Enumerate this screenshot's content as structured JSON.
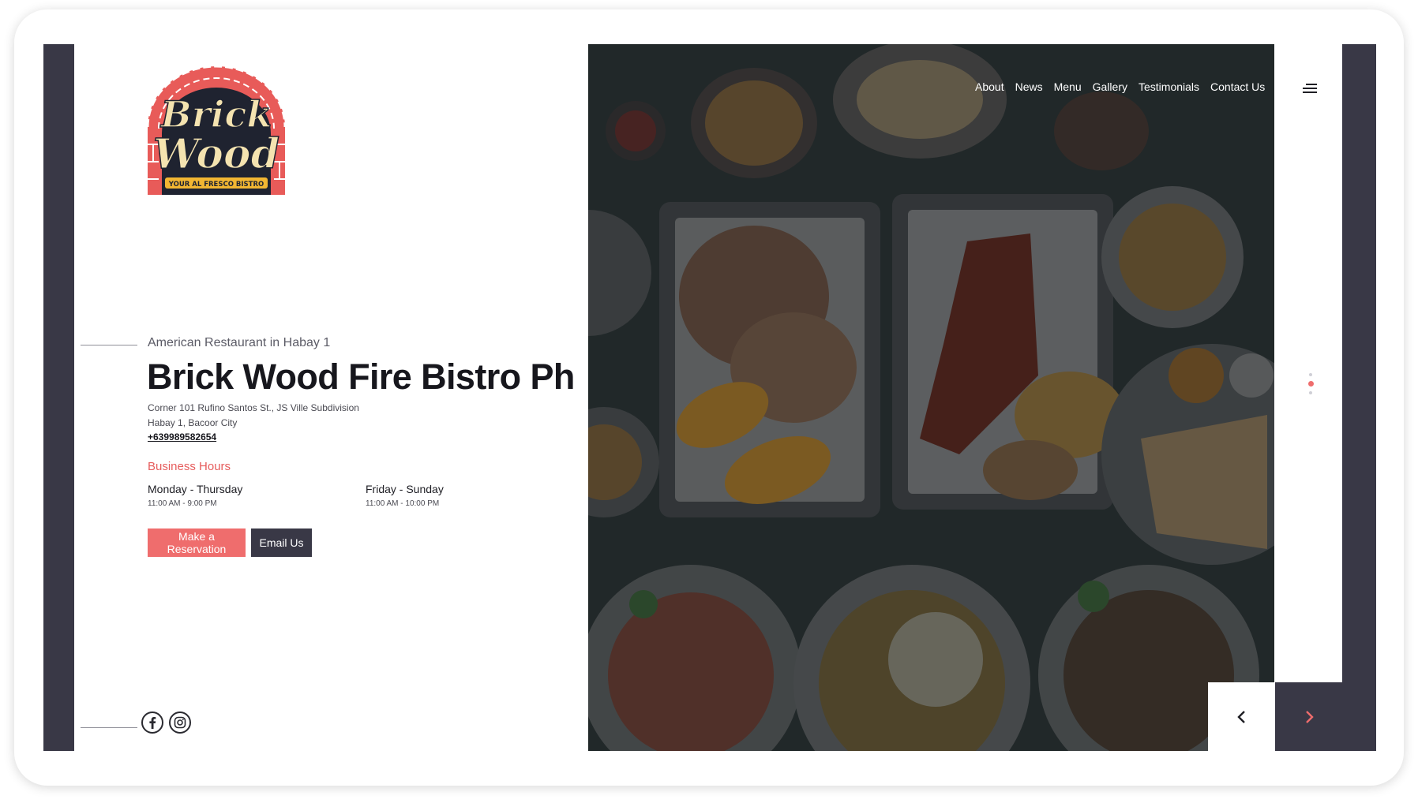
{
  "logo": {
    "line1": "Brick",
    "line2": "Wood",
    "tagline": "YOUR AL FRESCO BISTRO"
  },
  "nav": {
    "items": [
      "About",
      "News",
      "Menu",
      "Gallery",
      "Testimonials",
      "Contact Us"
    ]
  },
  "hero": {
    "kicker": "American Restaurant in Habay 1",
    "title": "Brick Wood Fire Bistro Ph",
    "address_line1": "Corner 101 Rufino Santos St., JS Ville Subdivision",
    "address_line2": "Habay 1, Bacoor City",
    "phone": "+639989582654",
    "hours_title": "Business Hours",
    "hours": [
      {
        "days": "Monday - Thursday",
        "time": "11:00 AM - 9:00 PM"
      },
      {
        "days": "Friday - Sunday",
        "time": "11:00 AM - 10:00 PM"
      }
    ],
    "reserve_label": "Make a Reservation",
    "email_label": "Email Us"
  },
  "slider": {
    "dot_count": 3,
    "active_index": 1
  },
  "social": {
    "icons": [
      "facebook-icon",
      "instagram-icon"
    ]
  },
  "colors": {
    "accent": "#ef6d6d",
    "dark": "#393846",
    "text": "#17171d"
  }
}
